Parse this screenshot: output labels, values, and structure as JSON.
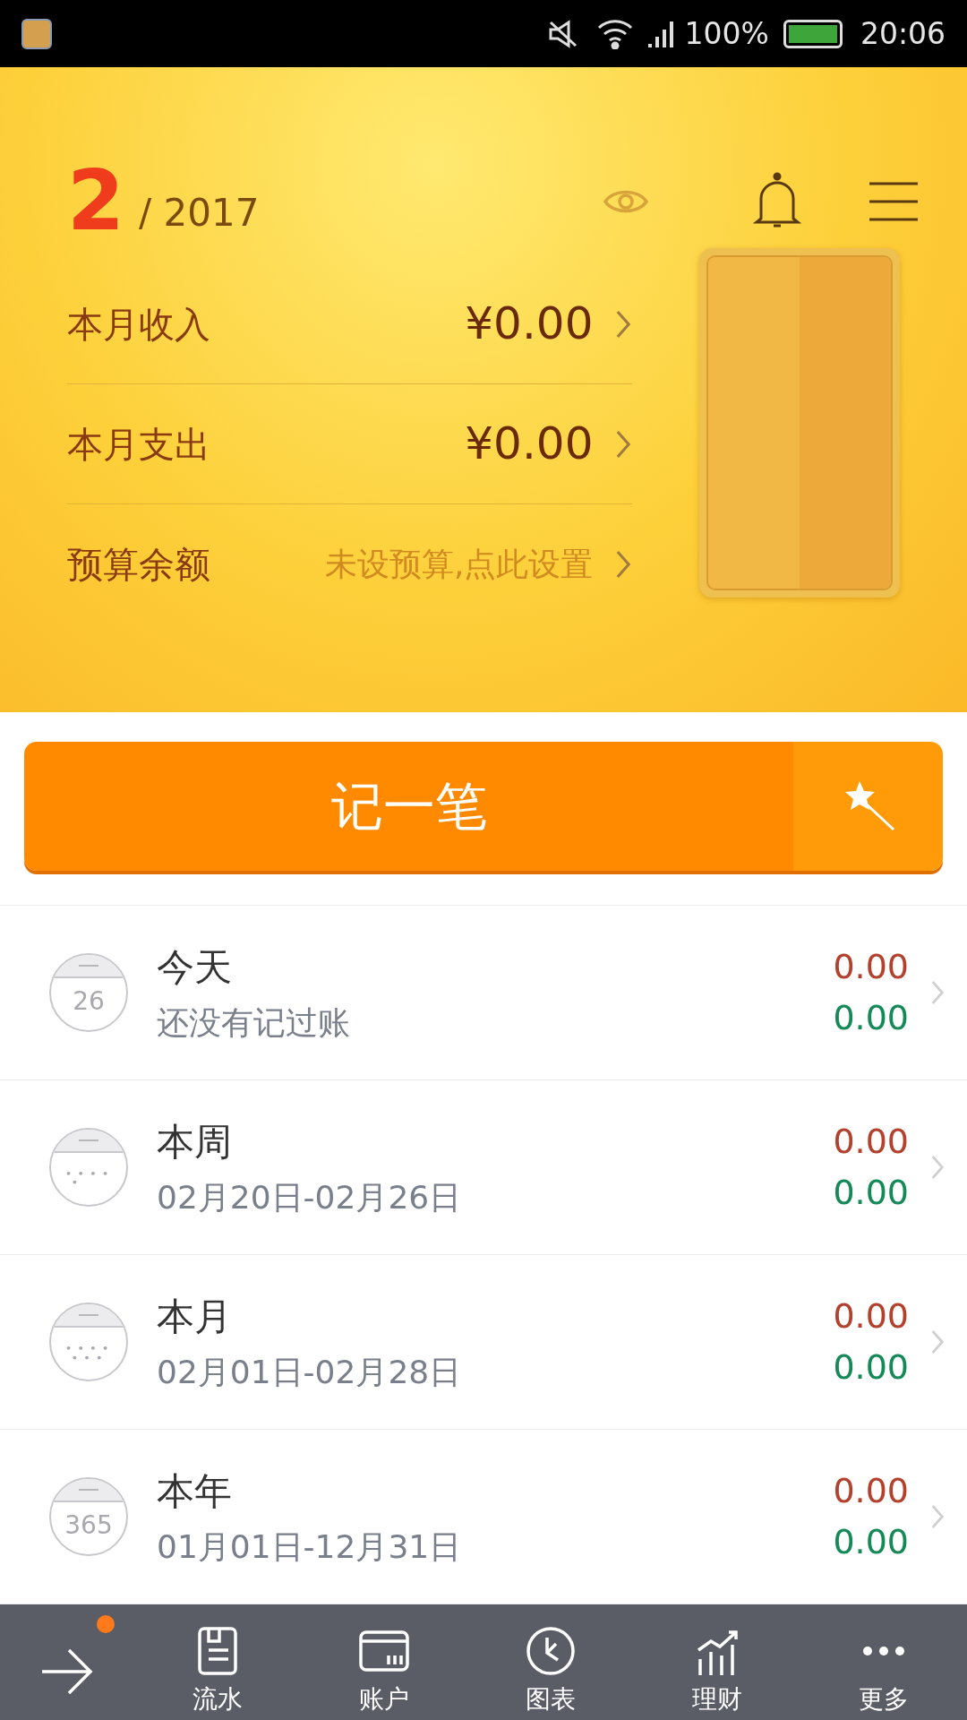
{
  "status_bar": {
    "battery": "100%",
    "time": "20:06"
  },
  "header": {
    "month": "2",
    "year": "/ 2017",
    "rows": [
      {
        "label": "本月收入",
        "value": "¥0.00",
        "kind": "amount"
      },
      {
        "label": "本月支出",
        "value": "¥0.00",
        "kind": "amount"
      },
      {
        "label": "预算余额",
        "value": "未设预算,点此设置",
        "kind": "hint"
      }
    ]
  },
  "record_button": {
    "label": "记一笔"
  },
  "periods": [
    {
      "title": "今天",
      "subtitle": "还没有记过账",
      "kind": "number",
      "icon_text": "26",
      "income": "0.00",
      "expense": "0.00"
    },
    {
      "title": "本周",
      "subtitle": "02月20日-02月26日",
      "kind": "week",
      "income": "0.00",
      "expense": "0.00"
    },
    {
      "title": "本月",
      "subtitle": "02月01日-02月28日",
      "kind": "month",
      "income": "0.00",
      "expense": "0.00"
    },
    {
      "title": "本年",
      "subtitle": "01月01日-12月31日",
      "kind": "number",
      "icon_text": "365",
      "income": "0.00",
      "expense": "0.00"
    }
  ],
  "nav": [
    {
      "label": "流水",
      "kind": "doc"
    },
    {
      "label": "账户",
      "kind": "card"
    },
    {
      "label": "图表",
      "kind": "clock"
    },
    {
      "label": "理财",
      "kind": "chart"
    },
    {
      "label": "更多",
      "kind": "dots"
    }
  ],
  "nav_badge": true
}
